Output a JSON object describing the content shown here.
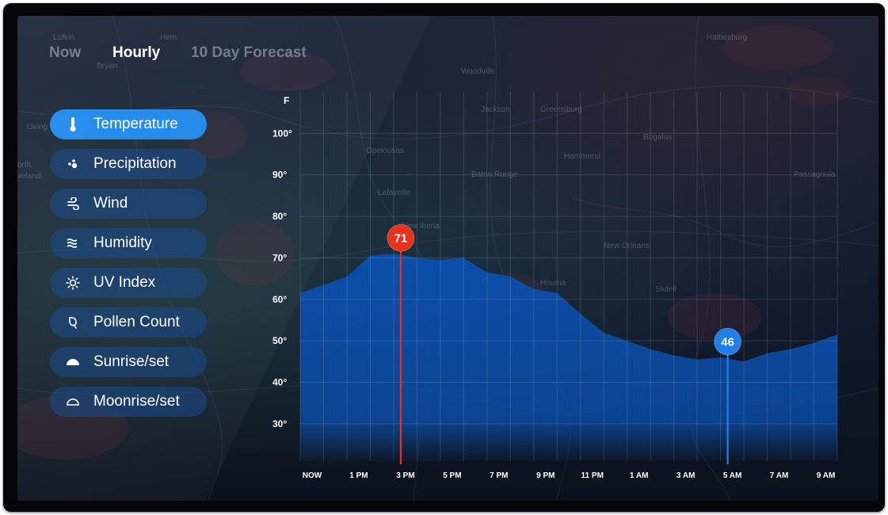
{
  "tabs": [
    {
      "label": "Now",
      "active": false
    },
    {
      "label": "Hourly",
      "active": true
    },
    {
      "label": "10 Day Forecast",
      "active": false
    }
  ],
  "metrics": [
    {
      "label": "Temperature",
      "icon": "thermometer-icon",
      "active": true
    },
    {
      "label": "Precipitation",
      "icon": "precipitation-icon",
      "active": false
    },
    {
      "label": "Wind",
      "icon": "wind-icon",
      "active": false
    },
    {
      "label": "Humidity",
      "icon": "humidity-icon",
      "active": false
    },
    {
      "label": "UV Index",
      "icon": "sun-icon",
      "active": false
    },
    {
      "label": "Pollen Count",
      "icon": "pollen-icon",
      "active": false
    },
    {
      "label": "Sunrise/set",
      "icon": "sunrise-icon",
      "active": false
    },
    {
      "label": "Moonrise/set",
      "icon": "moonrise-icon",
      "active": false
    }
  ],
  "map_labels": [
    "Lufkin",
    "Hattiesburg",
    "Woodville",
    "Jackson",
    "Greensburg",
    "Bogalus",
    "Baton Rouge",
    "Hammond",
    "Lafayette",
    "Opelousas",
    "New Iberia",
    "New Orleans",
    "Houma",
    "Slidell",
    "Pascagoula",
    "Living",
    "orth",
    "veland",
    "Bryan",
    "Hem"
  ],
  "colors": {
    "accent": "#1a86ea",
    "area_fill": "#0a4fae",
    "high_marker": "#e8321e",
    "low_marker": "#1f7fe6",
    "inactive_button": "#103f80"
  },
  "chart_data": {
    "type": "area",
    "unit_label": "F",
    "x": [
      "NOW",
      "",
      "1 PM",
      "",
      "3 PM",
      "",
      "5 PM",
      "",
      "7 PM",
      "",
      "9 PM",
      "",
      "11 PM",
      "",
      "1 AM",
      "",
      "3 AM",
      "",
      "5 AM",
      "",
      "7 AM",
      "",
      "9 AM",
      ""
    ],
    "tick_labels": [
      "NOW",
      "1 PM",
      "3 PM",
      "5 PM",
      "7 PM",
      "9 PM",
      "11 PM",
      "1 AM",
      "3 AM",
      "5 AM",
      "7 AM",
      "9 AM"
    ],
    "values": [
      61.5,
      63.5,
      65.5,
      70.5,
      71,
      70,
      69.5,
      70,
      66.5,
      65.5,
      62.5,
      61.5,
      56.5,
      52,
      50,
      48,
      46.5,
      45.5,
      46,
      45,
      47,
      48,
      49.5,
      51.5
    ],
    "y_ticks": [
      "100°",
      "90°",
      "80°",
      "70°",
      "60°",
      "50°",
      "40°",
      "30°"
    ],
    "y_tick_values": [
      100,
      90,
      80,
      70,
      60,
      50,
      40,
      30
    ],
    "ylim": [
      21,
      110
    ],
    "grid": true,
    "annotations": [
      {
        "label": "71",
        "value": 71,
        "x_index": 4,
        "kind": "high"
      },
      {
        "label": "46",
        "value": 46,
        "x_index": 18,
        "kind": "low"
      }
    ]
  }
}
